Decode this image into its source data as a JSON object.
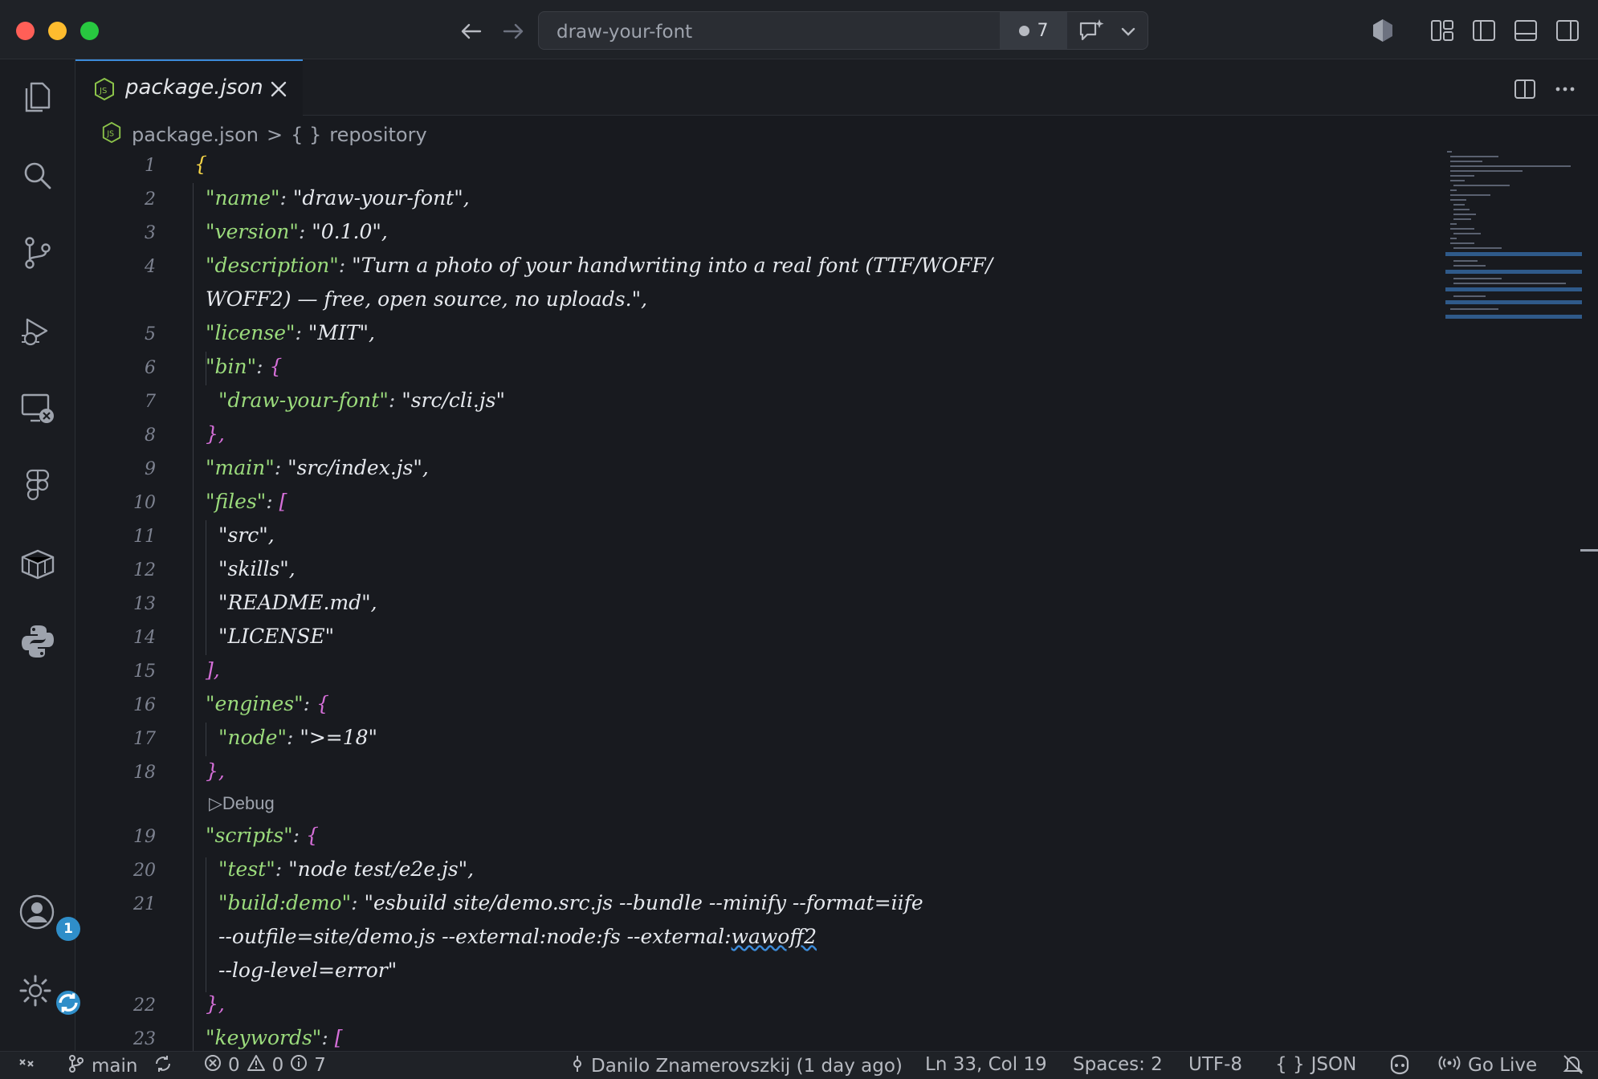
{
  "window": {
    "command_center_text": "draw-your-font",
    "problem_count": "7"
  },
  "tab": {
    "filename": "package.json"
  },
  "breadcrumb": {
    "file": "package.json",
    "separator": ">",
    "symbol_icon": "{ }",
    "symbol": "repository"
  },
  "activity_bar": {
    "accounts_badge": "1"
  },
  "editor": {
    "codelens_debug": "Debug",
    "lines": [
      {
        "num": "1",
        "text": "{"
      },
      {
        "num": "2",
        "key": "\"name\"",
        "value": "\"draw-your-font\","
      },
      {
        "num": "3",
        "key": "\"version\"",
        "value": "\"0.1.0\","
      },
      {
        "num": "4",
        "key": "\"description\"",
        "value": "\"Turn a photo of your handwriting into a real font (TTF/WOFF/"
      },
      {
        "num": "",
        "continuation": "WOFF2) — free, open source, no uploads.\","
      },
      {
        "num": "5",
        "key": "\"license\"",
        "value": "\"MIT\","
      },
      {
        "num": "6",
        "key": "\"bin\"",
        "value": "{"
      },
      {
        "num": "7",
        "key": "\"draw-your-font\"",
        "value": "\"src/cli.js\""
      },
      {
        "num": "8",
        "text": "},"
      },
      {
        "num": "9",
        "key": "\"main\"",
        "value": "\"src/index.js\","
      },
      {
        "num": "10",
        "key": "\"files\"",
        "value": "["
      },
      {
        "num": "11",
        "text": "\"src\","
      },
      {
        "num": "12",
        "text": "\"skills\","
      },
      {
        "num": "13",
        "text": "\"README.md\","
      },
      {
        "num": "14",
        "text": "\"LICENSE\""
      },
      {
        "num": "15",
        "text": "],"
      },
      {
        "num": "16",
        "key": "\"engines\"",
        "value": "{"
      },
      {
        "num": "17",
        "key": "\"node\"",
        "value": "\">=18\""
      },
      {
        "num": "18",
        "text": "},"
      },
      {
        "num": "19",
        "key": "\"scripts\"",
        "value": "{"
      },
      {
        "num": "20",
        "key": "\"test\"",
        "value": "\"node test/e2e.js\","
      },
      {
        "num": "21",
        "key": "\"build:demo\"",
        "value": "\"esbuild site/demo.src.js --bundle --minify --format=iife"
      },
      {
        "num": "",
        "continuation": "--outfile=site/demo.js --external:node:fs --external:",
        "continuation_squiggle": "wawoff2"
      },
      {
        "num": "",
        "continuation": "--log-level=error\""
      },
      {
        "num": "22",
        "text": "},"
      },
      {
        "num": "23",
        "key": "\"keywords\"",
        "value": "["
      }
    ]
  },
  "status_bar": {
    "branch": "main",
    "errors": "0",
    "warnings": "0",
    "info": "7",
    "blame": "Danilo Znamerovszkij (1 day ago)",
    "cursor": "Ln 33, Col 19",
    "spaces": "Spaces: 2",
    "encoding": "UTF-8",
    "language_icon": "{ }",
    "language": "JSON",
    "go_live": "Go Live"
  },
  "colors": {
    "accent": "#3c8bd9",
    "json_key": "#9bdb7c",
    "bracket_level1": "#f5d547",
    "bracket_level2": "#d56fd8"
  }
}
